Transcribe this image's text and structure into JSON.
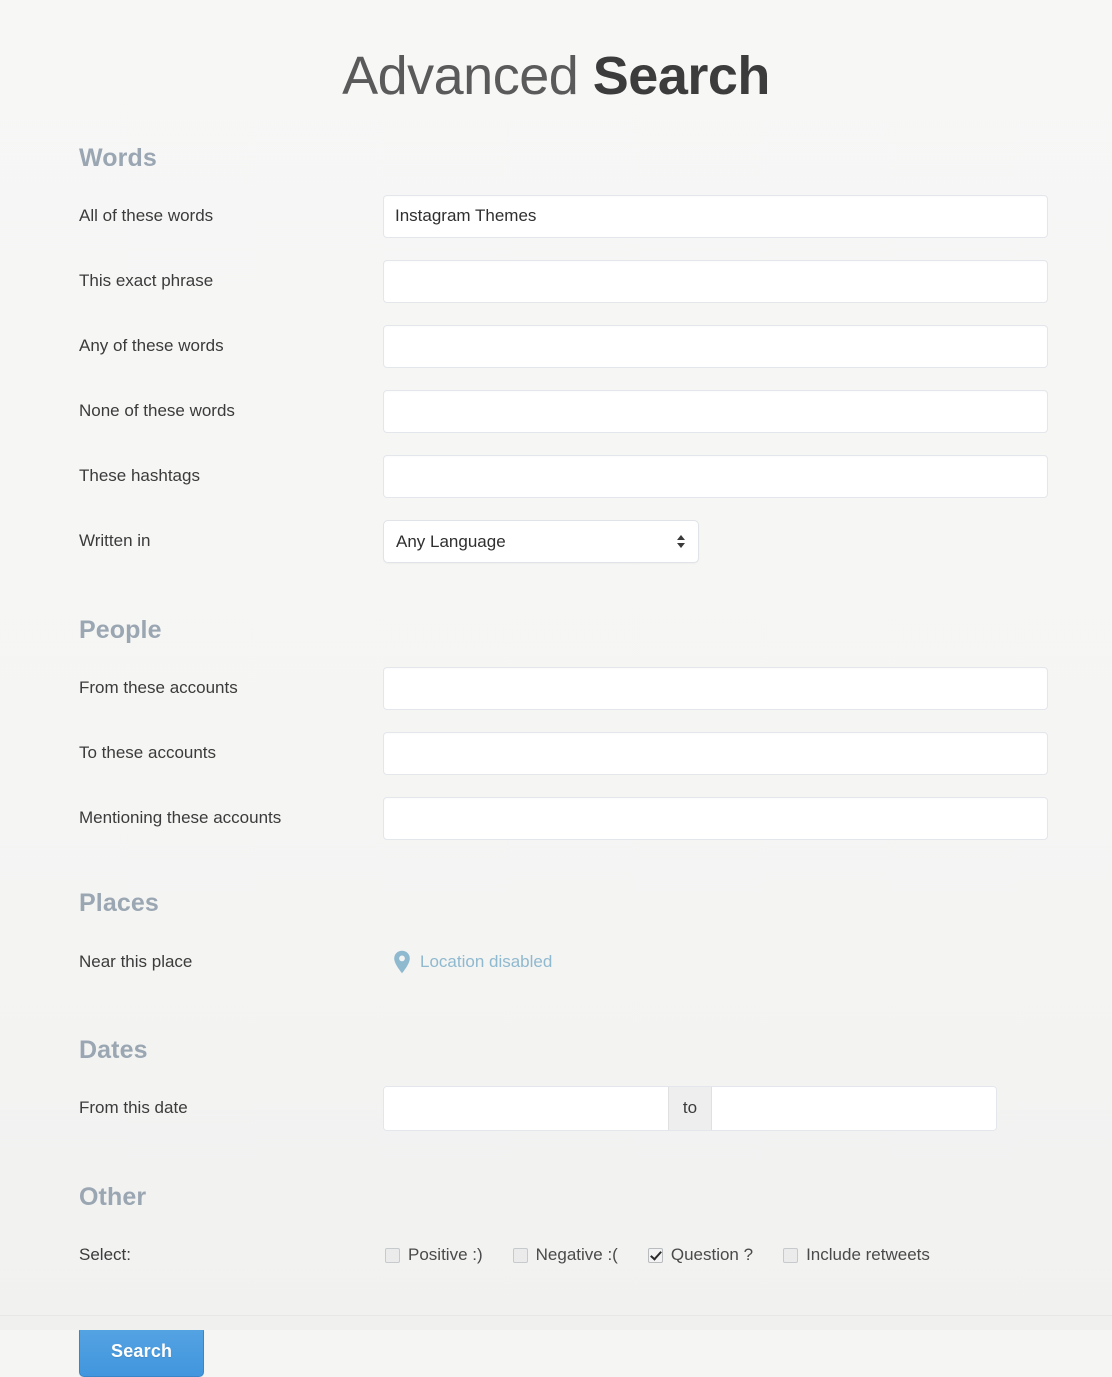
{
  "page": {
    "title_thin": "Advanced ",
    "title_bold": "Search"
  },
  "sections": {
    "words": {
      "heading": "Words",
      "fields": [
        {
          "label": "All of these words",
          "value": "Instagram Themes",
          "placeholder": ""
        },
        {
          "label": "This exact phrase",
          "value": "",
          "placeholder": ""
        },
        {
          "label": "Any of these words",
          "value": "",
          "placeholder": ""
        },
        {
          "label": "None of these words",
          "value": "",
          "placeholder": ""
        },
        {
          "label": "These hashtags",
          "value": "",
          "placeholder": ""
        }
      ],
      "language": {
        "label": "Written in",
        "selected": "Any Language",
        "options": [
          "Any Language"
        ]
      }
    },
    "people": {
      "heading": "People",
      "fields": [
        {
          "label": "From these accounts",
          "value": "",
          "placeholder": ""
        },
        {
          "label": "To these accounts",
          "value": "",
          "placeholder": ""
        },
        {
          "label": "Mentioning these accounts",
          "value": "",
          "placeholder": ""
        }
      ]
    },
    "places": {
      "heading": "Places",
      "label": "Near this place",
      "status": "Location disabled",
      "icon": "map-pin-icon",
      "icon_color": "#8fb9cf"
    },
    "dates": {
      "heading": "Dates",
      "label": "From this date",
      "from_value": "",
      "to_value": "",
      "separator": "to"
    },
    "other": {
      "heading": "Other",
      "label": "Select:",
      "checkboxes": [
        {
          "label": "Positive :)",
          "checked": false
        },
        {
          "label": "Negative :(",
          "checked": false
        },
        {
          "label": "Question ?",
          "checked": true
        },
        {
          "label": "Include retweets",
          "checked": false
        }
      ]
    }
  },
  "actions": {
    "search_label": "Search",
    "search_color": "#4196dd"
  }
}
